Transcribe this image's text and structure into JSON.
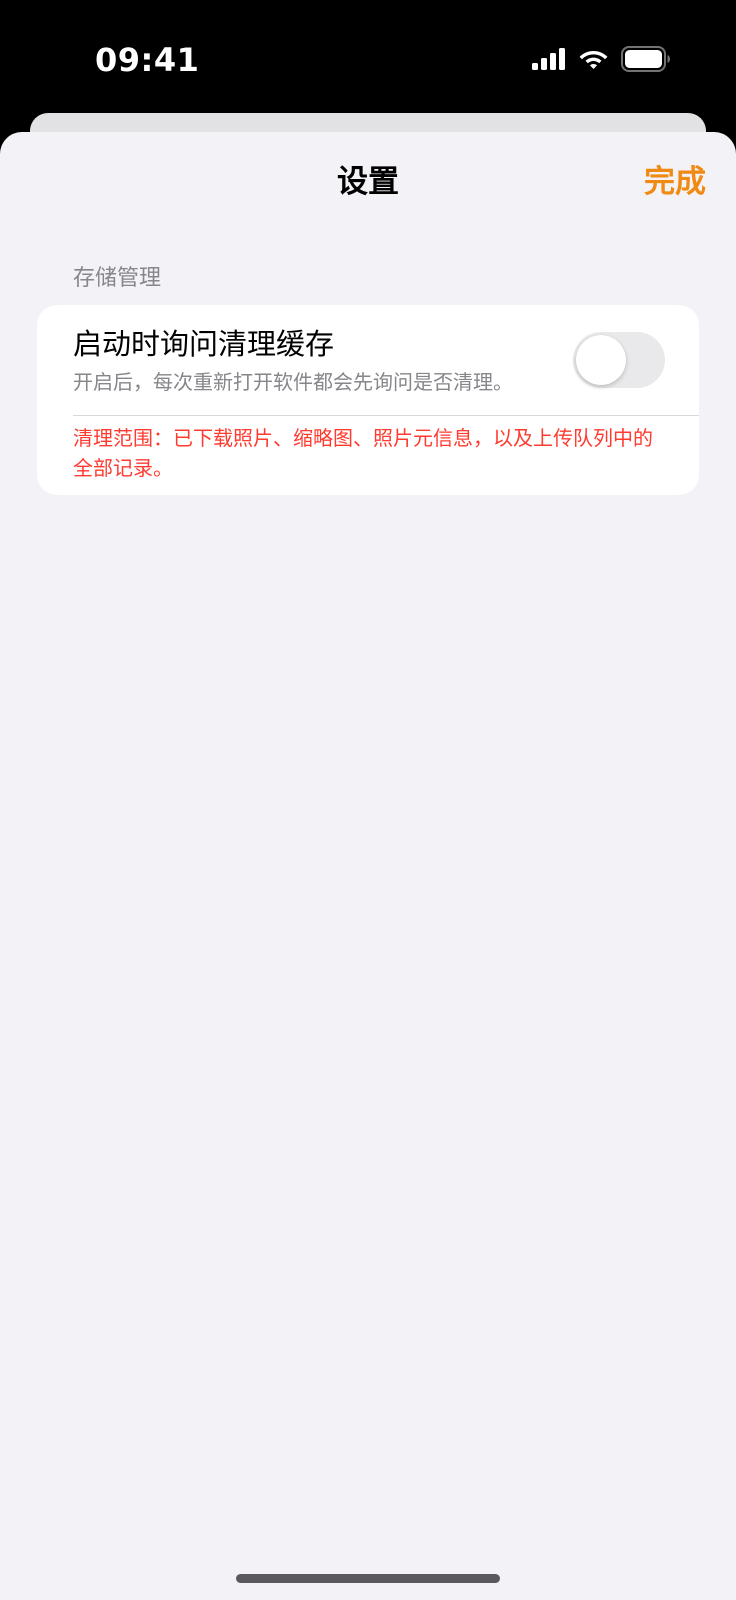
{
  "status_bar": {
    "time": "09:41",
    "icons": [
      "cellular-signal-icon",
      "wifi-icon",
      "battery-icon"
    ]
  },
  "nav": {
    "title": "设置",
    "done_label": "完成"
  },
  "section": {
    "header": "存储管理"
  },
  "row": {
    "title": "启动时询问清理缓存",
    "subtitle": "开启后，每次重新打开软件都会先询问是否清理。",
    "toggle_on": false
  },
  "warning": {
    "text": "清理范围：已下载照片、缩略图、照片元信息，以及上传队列中的全部记录。"
  },
  "colors": {
    "accent": "#f08a12",
    "warning": "#ff3b30",
    "background": "#f2f2f7"
  }
}
